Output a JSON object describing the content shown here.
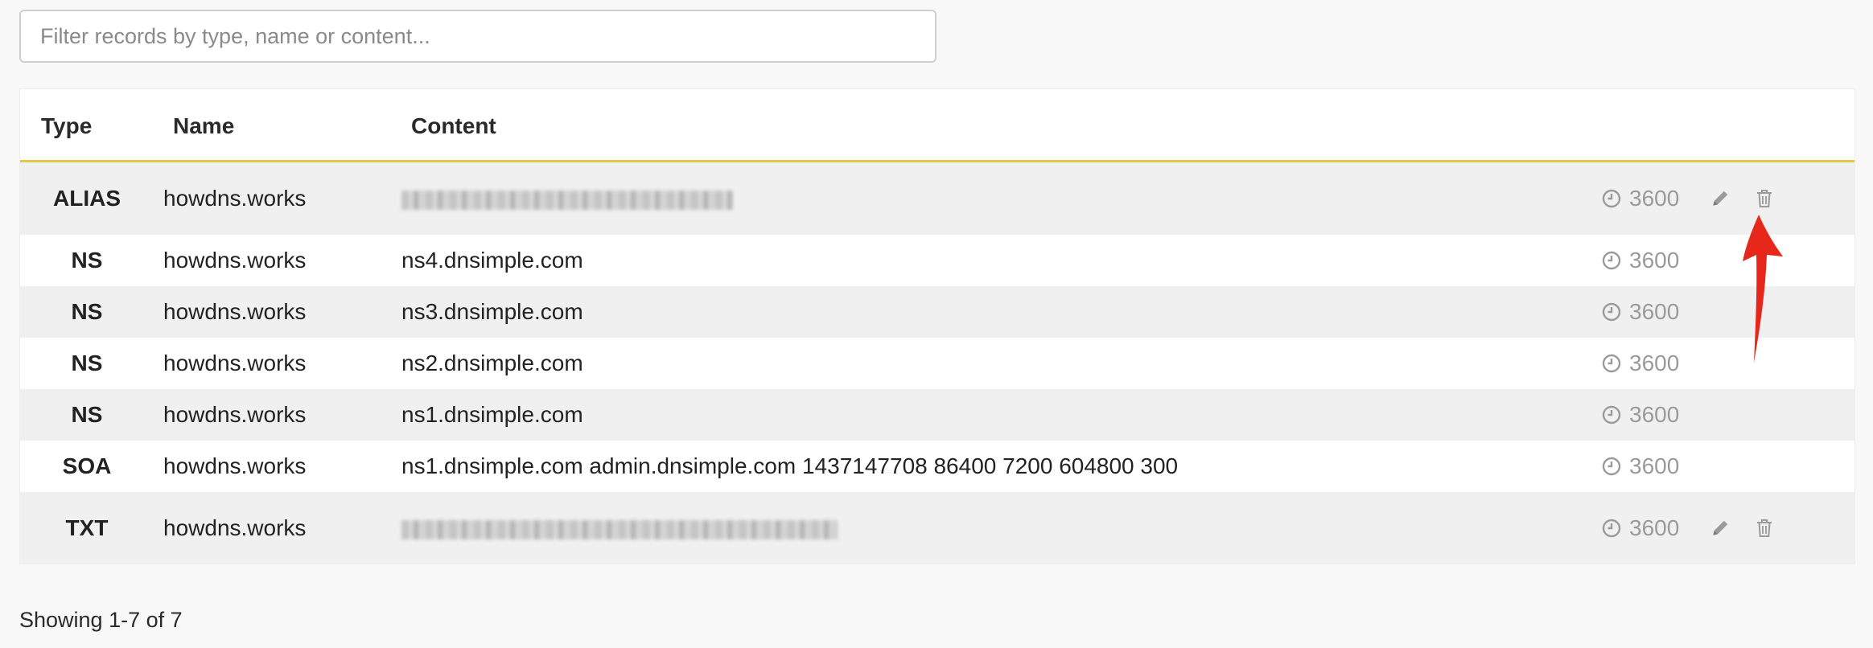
{
  "filter": {
    "placeholder": "Filter records by type, name or content...",
    "value": ""
  },
  "table": {
    "headers": {
      "type": "Type",
      "name": "Name",
      "content": "Content"
    },
    "rows": [
      {
        "type": "ALIAS",
        "name": "howdns.works",
        "content": "",
        "ttl": "3600",
        "editable": true
      },
      {
        "type": "NS",
        "name": "howdns.works",
        "content": "ns4.dnsimple.com",
        "ttl": "3600",
        "editable": false
      },
      {
        "type": "NS",
        "name": "howdns.works",
        "content": "ns3.dnsimple.com",
        "ttl": "3600",
        "editable": false
      },
      {
        "type": "NS",
        "name": "howdns.works",
        "content": "ns2.dnsimple.com",
        "ttl": "3600",
        "editable": false
      },
      {
        "type": "NS",
        "name": "howdns.works",
        "content": "ns1.dnsimple.com",
        "ttl": "3600",
        "editable": false
      },
      {
        "type": "SOA",
        "name": "howdns.works",
        "content": "ns1.dnsimple.com admin.dnsimple.com 1437147708 86400 7200 604800 300",
        "ttl": "3600",
        "editable": false
      },
      {
        "type": "TXT",
        "name": "howdns.works",
        "content": "",
        "ttl": "3600",
        "editable": true
      }
    ]
  },
  "footer": {
    "showing": "Showing 1-7 of 7"
  },
  "colors": {
    "header_underline": "#e8c547",
    "arrow": "#e8271b",
    "ttl_text": "#9a9a9a"
  },
  "icons": {
    "ttl": "clock-icon",
    "edit": "pencil-icon",
    "delete": "trash-icon"
  }
}
